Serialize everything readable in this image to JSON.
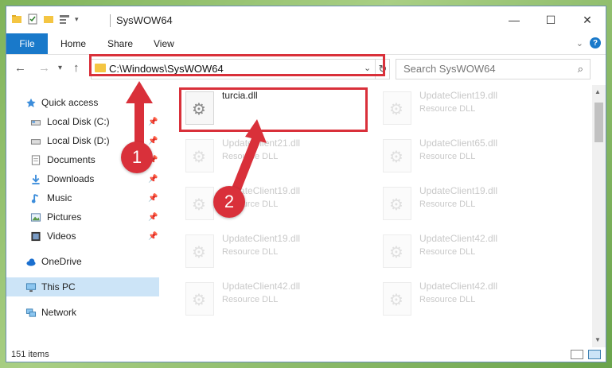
{
  "window": {
    "title": "SysWOW64"
  },
  "window_controls": {
    "minimize": "—",
    "maximize": "☐",
    "close": "✕"
  },
  "ribbon": {
    "file_tab": "File",
    "tabs": [
      "Home",
      "Share",
      "View"
    ],
    "help": "?"
  },
  "nav": {
    "back": "←",
    "forward": "→",
    "recent": "▾",
    "up": "↑"
  },
  "address": {
    "path": "C:\\Windows\\SysWOW64",
    "caret": "⌄",
    "refresh": "↻"
  },
  "search": {
    "placeholder": "Search SysWOW64",
    "icon": "⌕"
  },
  "sidebar": {
    "items": [
      {
        "label": "Quick access",
        "icon": "star-icon",
        "pinned": false
      },
      {
        "label": "Local Disk (C:)",
        "icon": "drive-icon",
        "pinned": true
      },
      {
        "label": "Local Disk (D:)",
        "icon": "drive-icon",
        "pinned": true
      },
      {
        "label": "Documents",
        "icon": "documents-icon",
        "pinned": true
      },
      {
        "label": "Downloads",
        "icon": "download-icon",
        "pinned": true
      },
      {
        "label": "Music",
        "icon": "music-icon",
        "pinned": true
      },
      {
        "label": "Pictures",
        "icon": "pictures-icon",
        "pinned": true
      },
      {
        "label": "Videos",
        "icon": "video-icon",
        "pinned": true
      },
      {
        "label": "OneDrive",
        "icon": "cloud-icon",
        "pinned": false
      },
      {
        "label": "This PC",
        "icon": "computer-icon",
        "pinned": false,
        "selected": true
      },
      {
        "label": "Network",
        "icon": "network-icon",
        "pinned": false
      }
    ]
  },
  "files": {
    "main": {
      "name": "turcia.dll",
      "type": ""
    },
    "col1": [
      {
        "name": "UpdateClient21.dll",
        "type": "Resource DLL"
      },
      {
        "name": "UpdateClient19.dll",
        "type": "Resource DLL"
      },
      {
        "name": "UpdateClient19.dll",
        "type": "Resource DLL"
      },
      {
        "name": "UpdateClient42.dll",
        "type": "Resource DLL"
      }
    ],
    "col2": [
      {
        "name": "UpdateClient19.dll",
        "type": "Resource DLL"
      },
      {
        "name": "UpdateClient65.dll",
        "type": "Resource DLL"
      },
      {
        "name": "UpdateClient19.dll",
        "type": "Resource DLL"
      },
      {
        "name": "UpdateClient42.dll",
        "type": "Resource DLL"
      },
      {
        "name": "UpdateClient42.dll",
        "type": "Resource DLL"
      }
    ]
  },
  "status": {
    "count": "151 items"
  },
  "annotations": {
    "step1": "1",
    "step2": "2",
    "highlight_color": "#d9303a"
  }
}
